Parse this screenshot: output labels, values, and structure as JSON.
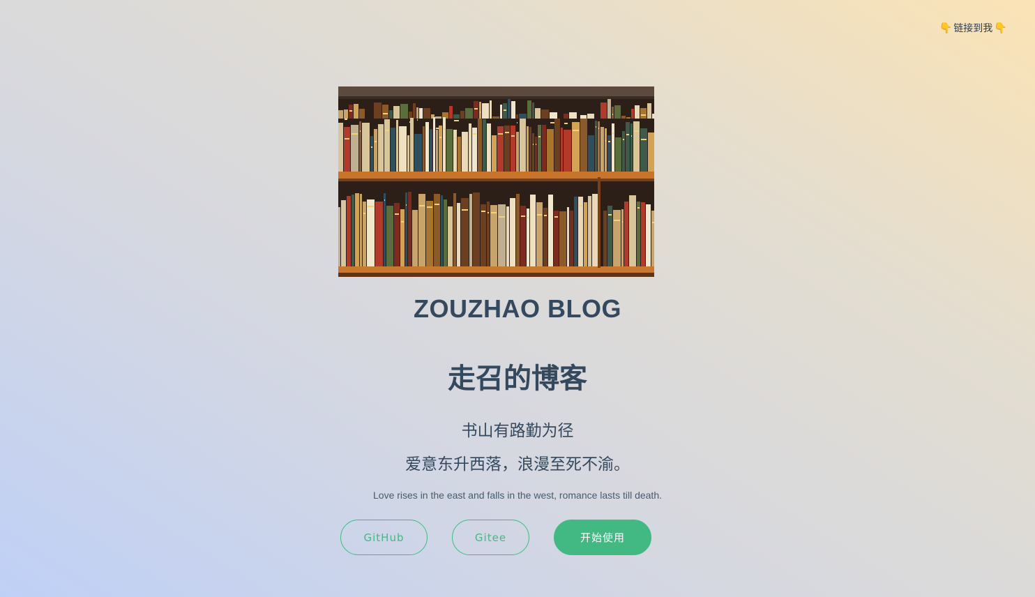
{
  "header": {
    "link_label": "链接到我",
    "left_icon": "pointing-hand-icon",
    "right_icon": "pointing-hand-icon"
  },
  "hero": {
    "image": "bookshelf-photo",
    "name": "ZOUZHAO BLOG",
    "title": "走召的博客",
    "line1": "书山有路勤为径",
    "line2": "爱意东升西落，浪漫至死不渝。",
    "tagline_en": "Love rises in the east and falls in the west, romance lasts till death."
  },
  "buttons": {
    "github": "GitHub",
    "gitee": "Gitee",
    "start": "开始使用"
  },
  "colors": {
    "accent": "#42b983",
    "text": "#34495e"
  }
}
